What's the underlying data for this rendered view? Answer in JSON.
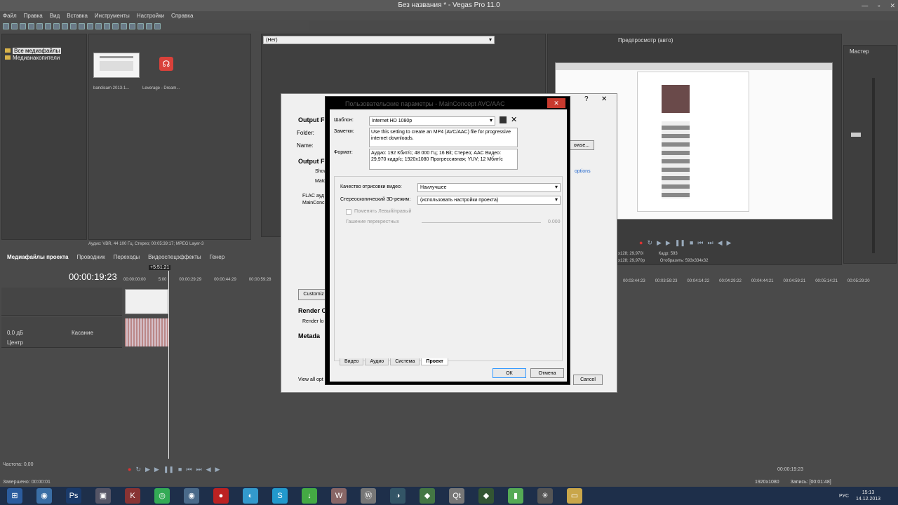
{
  "window": {
    "title": "Без названия * - Vegas Pro 11.0",
    "minimize": "—",
    "maximize": "▫",
    "close": "✕"
  },
  "menu": [
    "Файл",
    "Правка",
    "Вид",
    "Вставка",
    "Инструменты",
    "Настройки",
    "Справка"
  ],
  "explorer": {
    "tree": [
      "Все медиафайлы",
      "Медианакопители"
    ],
    "thumbs": [
      {
        "label": "bandicam 2013-1..."
      },
      {
        "label": "Leverage - Dream..."
      }
    ],
    "status": "Аудио: VBR, 44 100 Гц, Стерео; 00:05:39:17; MPEG Layer-3",
    "tabs": [
      "Медиафайлы проекта",
      "Проводник",
      "Переходы",
      "Видеоспецэффекты",
      "Генер"
    ]
  },
  "trimmer": {
    "dropdown": "(Нет)"
  },
  "preview": {
    "label": "Предпросмотр (авто)",
    "info": [
      {
        "k": "x128; 29,970i",
        "v": "Кадр:",
        "n": "593"
      },
      {
        "k": "x128; 29,970p",
        "v": "Отобразить:",
        "n": "593x334x32"
      }
    ]
  },
  "master": {
    "label": "Мастер"
  },
  "timeline": {
    "time": "00:00:19:23",
    "cursor": "+5:51:21",
    "ticks": [
      "00:00:00:00",
      "00:00:1",
      "5:00",
      "00:00:29:29",
      "00:00:44:29",
      "00:00:59:28"
    ],
    "ticks_right": [
      "00:03:44:23",
      "00:03:59:23",
      "00:04:14:22",
      "00:04:29:22",
      "00:04:44:21",
      "00:04:59:21",
      "00:05:14:21",
      "00:05:29:20"
    ],
    "audio": {
      "db": "0,0 дБ",
      "mode": "Касание",
      "pan": "Центр"
    },
    "rate": "Частота: 0,00",
    "end_time": "00:00:19:23",
    "complete": "Завершено: 00:00:01"
  },
  "bg_dialog": {
    "output_format": "Output F",
    "folder": "Folder:",
    "name": "Name:",
    "output_f2": "Output F",
    "show": "Show",
    "match": "Matc",
    "flac": "FLAC ауд",
    "mainconcept": "MainConc",
    "browse": "owse...",
    "options": "options",
    "customize": "Customiz",
    "render_o": "Render O",
    "render_lo": "Render lo",
    "metadata": "Metada",
    "view_all": "View all opt",
    "cancel": "Cancel",
    "help": "?",
    "close": "✕"
  },
  "dialog": {
    "title": "Пользовательские параметры - MainConcept AVC/AAC",
    "template_label": "Шаблон:",
    "template_value": "Internet HD 1080p",
    "notes_label": "Заметки:",
    "notes_value": "Use this setting to create an MP4 (AVC/AAC) file for progressive internet downloads.",
    "format_label": "Формат:",
    "format_value": "Аудио: 192 Кбит/с; 48 000 Гц; 16 Bit; Стерео; AAC Видео: 29,970 кадр/с; 1920x1080 Прогрессивная; YUV; 12 Мбит/с",
    "quality_label": "Качество отрисовки видео:",
    "quality_value": "Наилучшее",
    "stereo_label": "Стереоскопический 3D-режим:",
    "stereo_value": "(использовать настройки проекта)",
    "swap_label": "Поменять Левый/правый",
    "crosstalk_label": "Гашение перекрестных",
    "crosstalk_value": "0.000",
    "tabs": [
      "Видео",
      "Аудио",
      "Система",
      "Проект"
    ],
    "ok": "ОК",
    "cancel": "Отмена"
  },
  "statusbar": {
    "resolution": "1920x1080",
    "record": "Запись: [00:01:48]",
    "lang": "РУС",
    "time": "15:13",
    "date": "14.12.2013"
  },
  "taskbar": [
    "Ps",
    "W",
    "Qt",
    "S"
  ]
}
